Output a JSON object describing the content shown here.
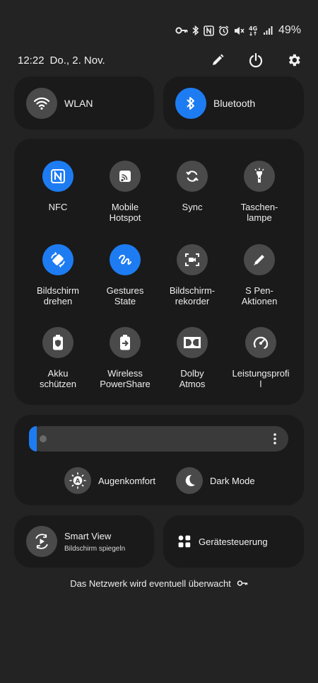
{
  "status_bar": {
    "icons": [
      "vpn-key-icon",
      "bluetooth-icon",
      "nfc-icon",
      "alarm-icon",
      "mute-icon",
      "4g-data-icon",
      "signal-icon"
    ],
    "battery": "49%"
  },
  "header": {
    "time": "12:22",
    "date": "Do., 2. Nov."
  },
  "top_tiles": [
    {
      "label": "WLAN",
      "active": false
    },
    {
      "label": "Bluetooth",
      "active": true
    }
  ],
  "quick_tiles": [
    {
      "line1": "NFC",
      "line2": "",
      "icon": "nfc-icon",
      "active": true
    },
    {
      "line1": "Mobile",
      "line2": "Hotspot",
      "icon": "hotspot-icon",
      "active": false
    },
    {
      "line1": "Sync",
      "line2": "",
      "icon": "sync-icon",
      "active": false
    },
    {
      "line1": "Taschen-",
      "line2": "lampe",
      "icon": "flashlight-icon",
      "active": false
    },
    {
      "line1": "Bildschirm",
      "line2": "drehen",
      "icon": "rotate-icon",
      "active": true
    },
    {
      "line1": "Gestures",
      "line2": "State",
      "icon": "gesture-icon",
      "active": true
    },
    {
      "line1": "Bildschirm-",
      "line2": "rekorder",
      "icon": "screen-recorder-icon",
      "active": false
    },
    {
      "line1": "S Pen-",
      "line2": "Aktionen",
      "icon": "pen-icon",
      "active": false
    },
    {
      "line1": "Akku",
      "line2": "schützen",
      "icon": "battery-protect-icon",
      "active": false
    },
    {
      "line1": "Wireless",
      "line2": "PowerShare",
      "icon": "powershare-icon",
      "active": false
    },
    {
      "line1": "Dolby",
      "line2": "Atmos",
      "icon": "dolby-icon",
      "active": false
    },
    {
      "line1": "Leistungsprofi",
      "line2": "l",
      "icon": "performance-icon",
      "active": false
    }
  ],
  "brightness": {
    "level": 0.03
  },
  "modes": {
    "eye_comfort": "Augenkomfort",
    "dark_mode": "Dark Mode"
  },
  "smart_view": {
    "title": "Smart View",
    "subtitle": "Bildschirm spiegeln"
  },
  "device_control": {
    "label": "Gerätesteuerung"
  },
  "footer": {
    "note": "Das Netzwerk wird eventuell überwacht"
  },
  "colors": {
    "accent": "#1e7cf2",
    "background": "#232323",
    "card": "#1a1a1a",
    "tile_off": "#4a4a4a"
  }
}
